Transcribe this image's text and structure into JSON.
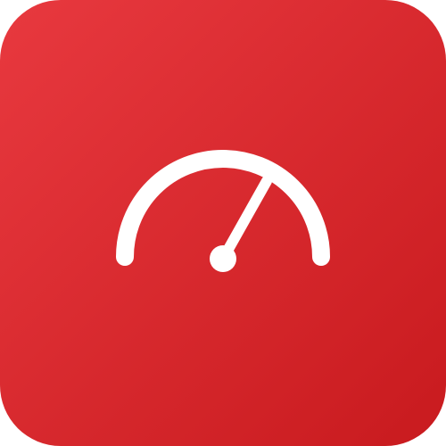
{
  "app_icon": {
    "name": "speedometer-app-icon",
    "icon": "speedometer-icon",
    "colors": {
      "background_start": "#E8393F",
      "background_end": "#C81A1E",
      "glyph": "#FFFFFF"
    }
  }
}
